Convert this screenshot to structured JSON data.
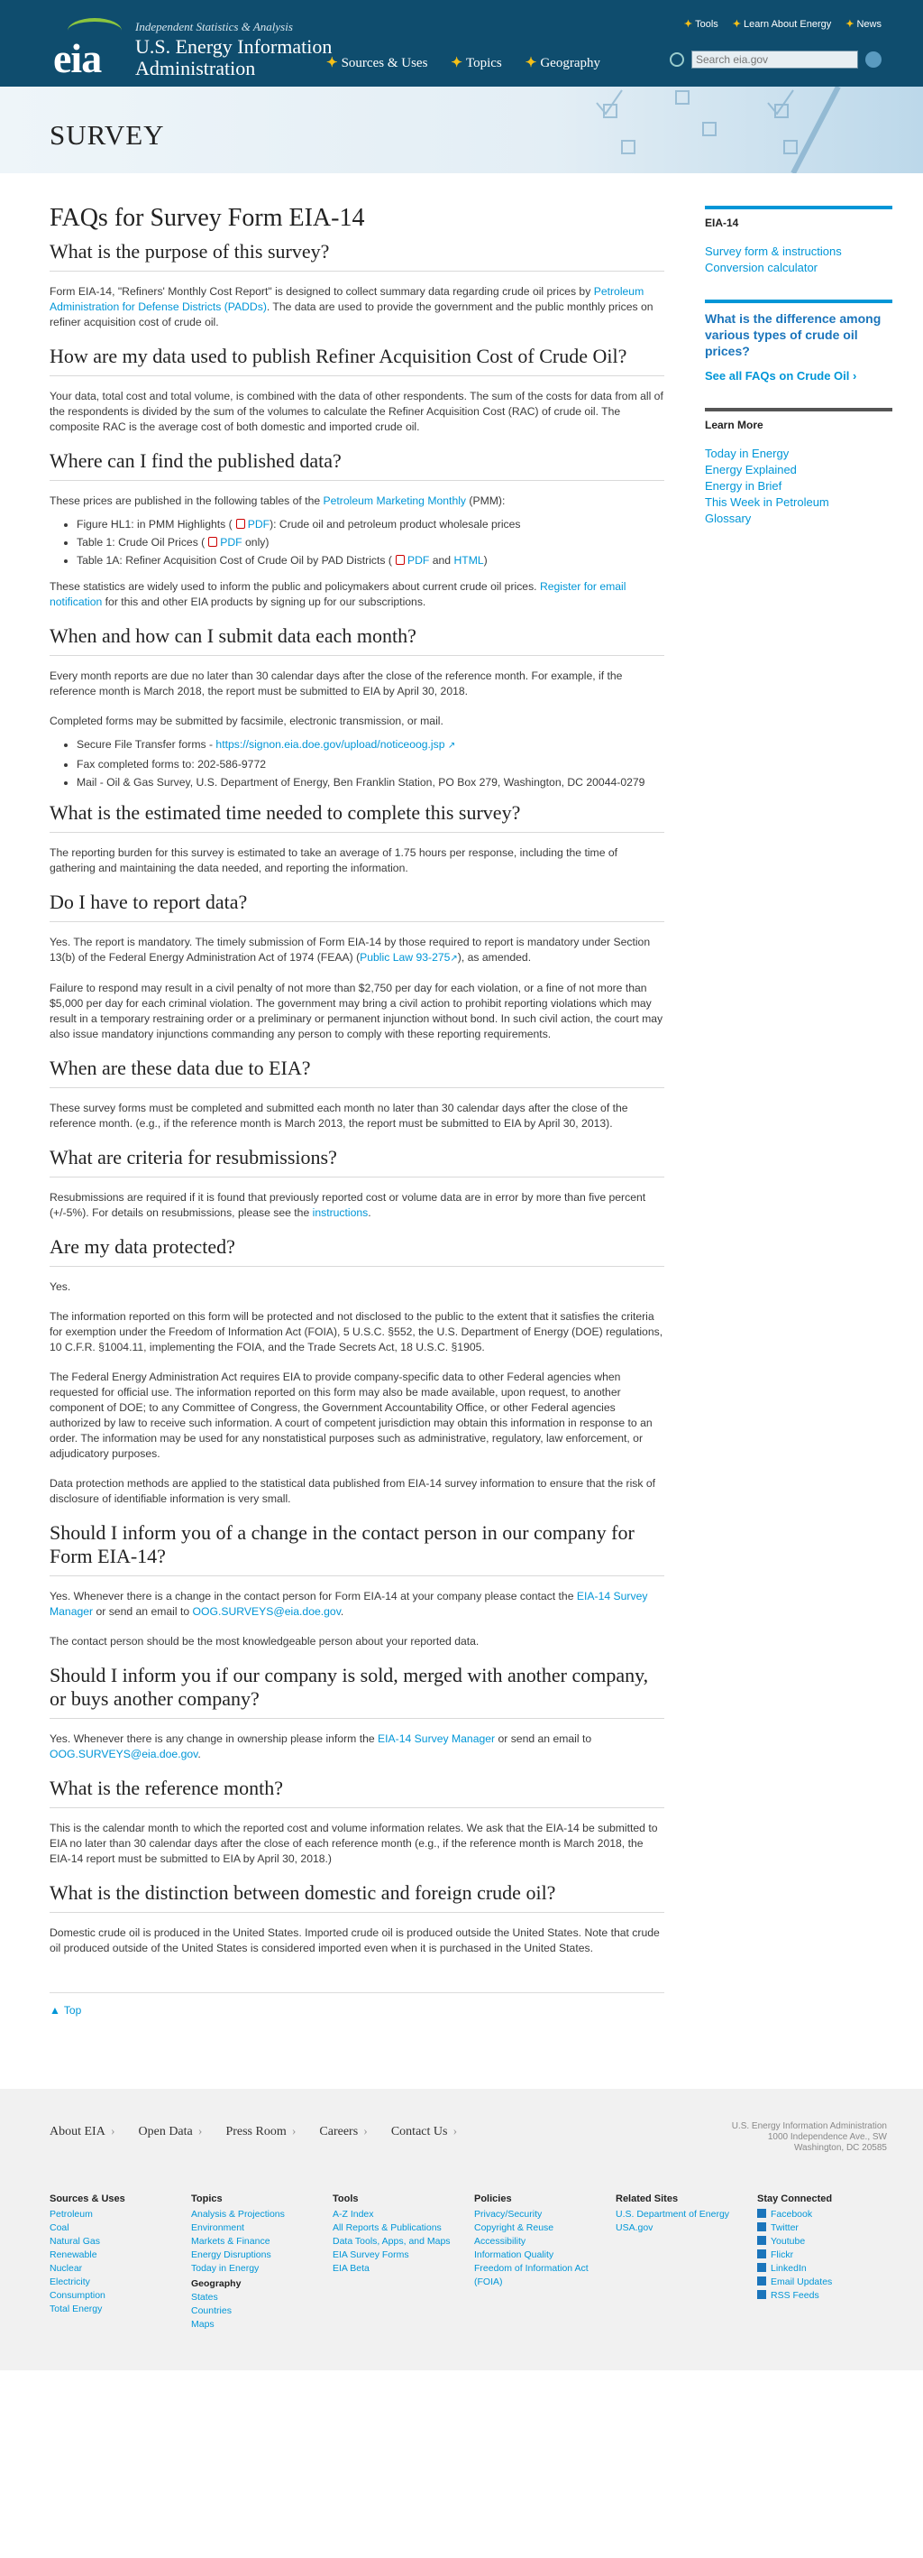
{
  "header": {
    "tagline": "Independent Statistics & Analysis",
    "agency": [
      "U.S. Energy Information",
      "Administration"
    ],
    "logo_text": "eia",
    "top_links": [
      "Tools",
      "Learn About Energy",
      "News"
    ],
    "main_nav": [
      "Sources & Uses",
      "Topics",
      "Geography"
    ],
    "search_placeholder": "Search eia.gov"
  },
  "banner": {
    "title": "SURVEY"
  },
  "page": {
    "title": "FAQs for Survey Form EIA-14",
    "purpose": {
      "q": "What is the purpose of this survey?",
      "p1a": "Form EIA-14, \"Refiners' Monthly Cost Report\" is designed to collect summary data regarding crude oil prices by ",
      "p1link": "Petroleum Administration for Defense Districts (PADDs)",
      "p1b": ". The data are used to provide the government and the public monthly prices on refiner acquisition cost of crude oil."
    },
    "publish": {
      "q": "How are my data used to publish Refiner Acquisition Cost of Crude Oil?",
      "p1": "Your data, total cost and total volume, is combined with the data of other respondents. The sum of the costs for data from all of the respondents is divided by the sum of the volumes to calculate the Refiner Acquisition Cost (RAC) of crude oil. The composite RAC is the average cost of both domestic and imported crude oil."
    },
    "find": {
      "q": "Where can I find the published data?",
      "p1a": "These prices are published in the following tables of the ",
      "p1link": "Petroleum Marketing Monthly",
      "p1b": " (PMM):",
      "items": [
        {
          "a": "Figure HL1: in PMM Highlights (",
          "pdf": "PDF",
          "b": "): Crude oil and petroleum product wholesale prices"
        },
        {
          "a": "Table 1: Crude Oil Prices (",
          "pdf": "PDF",
          "b": " only)"
        },
        {
          "a": "Table 1A: Refiner Acquisition Cost of Crude Oil by PAD Districts (",
          "pdf": "PDF",
          "mid": " and ",
          "html": "HTML",
          "b": ")"
        }
      ],
      "p2a": "These statistics are widely used to inform the public and policymakers about current crude oil prices. ",
      "p2link": "Register for email notification",
      "p2b": " for this and other EIA products by signing up for our subscriptions."
    },
    "submit": {
      "q": "When and how can I submit data each month?",
      "p1": "Every month reports are due no later than 30 calendar days after the close of the reference month. For example, if the reference month is March 2018, the report must be submitted to EIA by April 30, 2018.",
      "p2": "Completed forms may be submitted by facsimile, electronic transmission, or mail.",
      "items": [
        {
          "a": "Secure File Transfer forms - ",
          "link": "https://signon.eia.doe.gov/upload/noticeoog.jsp"
        },
        {
          "a": "Fax completed forms to: 202-586-9772"
        },
        {
          "a": "Mail - Oil & Gas Survey, U.S. Department of Energy, Ben Franklin Station, PO Box 279, Washington, DC 20044-0279"
        }
      ]
    },
    "time": {
      "q": "What is the estimated time needed to complete this survey?",
      "p1": "The reporting burden for this survey is estimated to take an average of 1.75 hours per response, including the time of gathering and maintaining the data needed, and reporting the information."
    },
    "report": {
      "q": "Do I have to report data?",
      "p1a": "Yes. The report is mandatory. The timely submission of Form EIA-14 by those required to report is mandatory under Section 13(b) of the Federal Energy Administration Act of 1974 (FEAA) (",
      "p1link": "Public Law 93-275",
      "p1b": "), as amended.",
      "p2": "Failure to respond may result in a civil penalty of not more than $2,750 per day for each violation, or a fine of not more than $5,000 per day for each criminal violation. The government may bring a civil action to prohibit reporting violations which may result in a temporary restraining order or a preliminary or permanent injunction without bond. In such civil action, the court may also issue mandatory injunctions commanding any person to comply with these reporting requirements."
    },
    "due": {
      "q": "When are these data due to EIA?",
      "p1": "These survey forms must be completed and submitted each month no later than 30 calendar days after the close of the reference month. (e.g., if the reference month is March 2013, the report must be submitted to EIA by April 30, 2013)."
    },
    "resub": {
      "q": "What are criteria for resubmissions?",
      "p1": "Resubmissions are required if it is found that previously reported cost or volume data are in error by more than five percent",
      "p2a": "(+/-5%). For details on resubmissions, please see the ",
      "p2link": "instructions",
      "p2b": "."
    },
    "protected": {
      "q": "Are my data protected?",
      "p1": "Yes.",
      "p2": "The information reported on this form will be protected and not disclosed to the public to the extent that it satisfies the criteria for exemption under the Freedom of Information Act (FOIA), 5 U.S.C. §552, the U.S. Department of Energy (DOE) regulations, 10 C.F.R. §1004.11, implementing the FOIA, and the Trade Secrets Act, 18 U.S.C. §1905.",
      "p3": "The Federal Energy Administration Act requires EIA to provide company-specific data to other Federal agencies when requested for official use. The information reported on this form may also be made available, upon request, to another component of DOE; to any Committee of Congress, the Government Accountability Office, or other Federal agencies authorized by law to receive such information. A court of competent jurisdiction may obtain this information in response to an order. The information may be used for any nonstatistical purposes such as administrative, regulatory, law enforcement, or adjudicatory purposes.",
      "p4": "Data protection methods are applied to the statistical data published from EIA-14 survey information to ensure that the risk of disclosure of identifiable information is very small."
    },
    "contact": {
      "q": "Should I inform you of a change in the contact person in our company for Form EIA-14?",
      "p1a": "Yes. Whenever there is a change in the contact person for Form EIA-14 at your company please contact the ",
      "p1link": "EIA-14 Survey Manager",
      "p1b": " or send an email to ",
      "p1email": "OOG.SURVEYS@eia.doe.gov",
      "p1c": ".",
      "p2": "The contact person should be the most knowledgeable person about your reported data."
    },
    "sold": {
      "q": "Should I inform you if our company is sold, merged with another company, or buys another company?",
      "p1a": "Yes. Whenever there is any change in ownership please inform the ",
      "p1link": "EIA-14 Survey Manager",
      "p1b": " or send an email to ",
      "p1email": "OOG.SURVEYS@eia.doe.gov",
      "p1c": "."
    },
    "refmonth": {
      "q": "What is the reference month?",
      "p1": "This is the calendar month to which the reported cost and volume information relates. We ask that the EIA-14 be submitted to EIA no later than 30 calendar days after the close of each reference month (e.g., if the reference month is March 2018, the EIA-14 report must be submitted to EIA by April 30, 2018.)"
    },
    "domestic": {
      "q": "What is the distinction between domestic and foreign crude oil?",
      "p1": "Domestic crude oil is produced in the United States. Imported crude oil is produced outside the United States. Note that crude oil produced outside of the United States is considered imported even when it is purchased in the United States."
    },
    "top": "Top"
  },
  "sidebar": {
    "box1_title": "EIA-14",
    "box1_links": [
      "Survey form & instructions",
      "Conversion calculator"
    ],
    "question": "What is the difference among various types of crude oil prices?",
    "see_all": "See all FAQs on Crude Oil ›",
    "learn_title": "Learn More",
    "learn_links": [
      "Today in Energy",
      "Energy Explained",
      "Energy in Brief",
      "This Week in Petroleum",
      "Glossary"
    ]
  },
  "footer": {
    "nav": [
      "About EIA",
      "Open Data",
      "Press Room",
      "Careers",
      "Contact Us"
    ],
    "address": [
      "U.S. Energy Information Administration",
      "1000 Independence Ave., SW",
      "Washington, DC 20585"
    ],
    "cols": [
      {
        "title": "Sources & Uses",
        "links": [
          "Petroleum",
          "Coal",
          "Natural Gas",
          "Renewable",
          "Nuclear",
          "Electricity",
          "Consumption",
          "Total Energy"
        ]
      },
      {
        "title": "Topics",
        "links": [
          "Analysis & Projections",
          "Environment",
          "Markets & Finance",
          "Energy Disruptions",
          "Today in Energy"
        ],
        "sub": "Geography",
        "sublinks": [
          "States",
          "Countries",
          "Maps"
        ]
      },
      {
        "title": "Tools",
        "links": [
          "A-Z Index",
          "All Reports & Publications",
          "Data Tools, Apps, and Maps",
          "EIA Survey Forms",
          "EIA Beta"
        ]
      },
      {
        "title": "Policies",
        "links": [
          "Privacy/Security",
          "Copyright & Reuse",
          "Accessibility",
          "Information Quality",
          "Freedom of Information Act (FOIA)"
        ]
      },
      {
        "title": "Related Sites",
        "links": [
          "U.S. Department of Energy",
          "USA.gov"
        ]
      },
      {
        "title": "Stay Connected",
        "links": [
          "Facebook",
          "Twitter",
          "Youtube",
          "Flickr",
          "LinkedIn",
          "Email Updates",
          "RSS Feeds"
        ]
      }
    ]
  }
}
